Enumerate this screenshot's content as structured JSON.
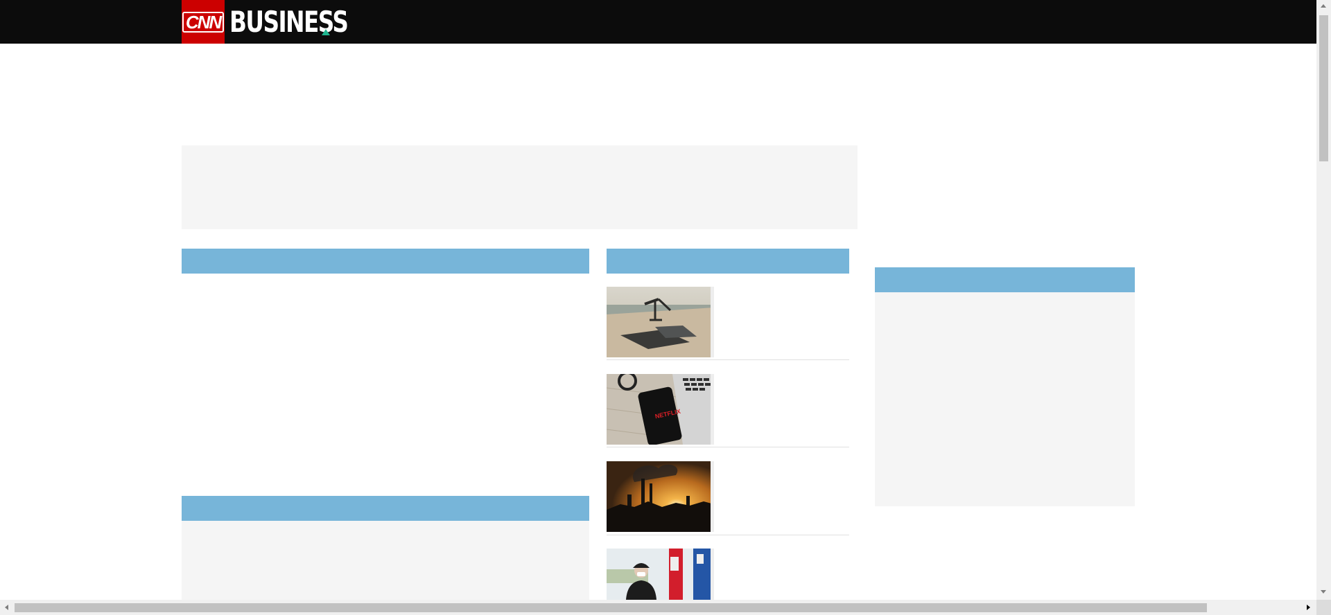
{
  "header": {
    "logo_text": "CNN",
    "brand_text": "BUSINESS",
    "accent_color": "#cc0000",
    "brand_triangle_color": "#1fb58f"
  },
  "colors": {
    "section_bar": "#77b5d9",
    "placeholder": "#f5f5f5",
    "topbar": "#0c0c0c"
  },
  "stories": [
    {
      "image": "oil-pumpjack-image"
    },
    {
      "image": "netflix-phone-laptop-image"
    },
    {
      "image": "refinery-sunset-image"
    },
    {
      "image": "gas-station-attendant-image"
    }
  ]
}
